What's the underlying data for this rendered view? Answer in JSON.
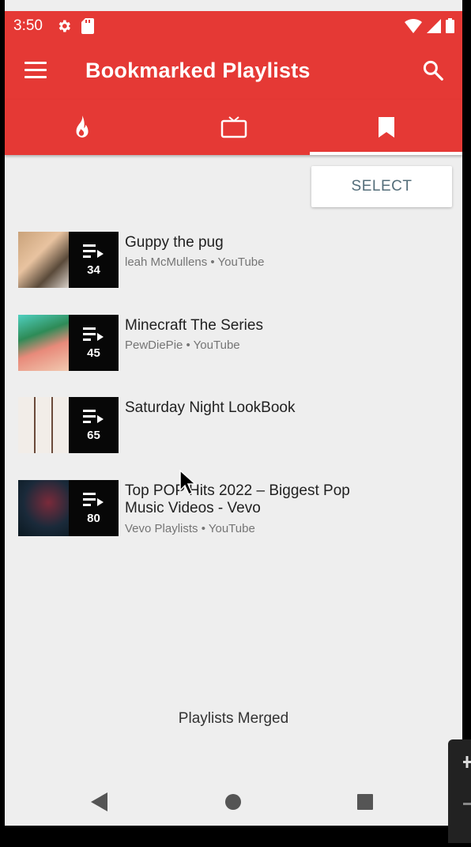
{
  "status_bar": {
    "time": "3:50"
  },
  "app_bar": {
    "title": "Bookmarked Playlists"
  },
  "tabs": [
    {
      "icon": "flame-icon",
      "selected": false
    },
    {
      "icon": "tv-icon",
      "selected": false
    },
    {
      "icon": "bookmark-icon",
      "selected": true
    }
  ],
  "select_label": "SELECT",
  "playlists": [
    {
      "title": "Guppy the pug",
      "subtitle": "leah McMullens • YouTube",
      "count": "34"
    },
    {
      "title": "Minecraft The Series",
      "subtitle": "PewDiePie • YouTube",
      "count": "45"
    },
    {
      "title": "Saturday Night LookBook",
      "subtitle": "",
      "count": "65"
    },
    {
      "title": "Top POP Hits 2022 – Biggest Pop Music Videos - Vevo",
      "subtitle": "Vevo Playlists • YouTube",
      "count": "80"
    }
  ],
  "snackbar": {
    "text": "Playlists Merged"
  },
  "colors": {
    "accent": "#e53935",
    "background": "#eeeeee"
  }
}
